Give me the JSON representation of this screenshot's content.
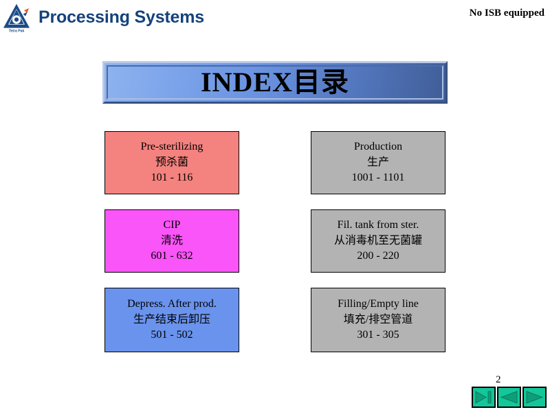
{
  "header": {
    "logo_name": "tetra-pak-logo",
    "logo_wordmark": "Tetra Pak",
    "title": "Processing Systems",
    "note": "No ISB equipped",
    "title_color": "#15427c"
  },
  "banner": {
    "title": "INDEX目录",
    "gradient_from": "#8fb3ef",
    "gradient_to": "#3f5d97"
  },
  "index_boxes": [
    {
      "id": "pre-sterilizing",
      "title_en": "Pre-sterilizing",
      "title_zh": "预杀菌",
      "range": "101 - 116",
      "color": "#F4827F"
    },
    {
      "id": "cip",
      "title_en": "CIP",
      "title_zh": "清洗",
      "range": "601 - 632",
      "color": "#FA55F8"
    },
    {
      "id": "depress-after-prod",
      "title_en": "Depress. After prod.",
      "title_zh": "生产结束后卸压",
      "range": "501 - 502",
      "color": "#6A93ED"
    },
    {
      "id": "production",
      "title_en": "Production",
      "title_zh": "生产",
      "range": "1001 - 1101",
      "color": "#B3B3B3"
    },
    {
      "id": "fil-tank-from-ster",
      "title_en": "Fil. tank from ster.",
      "title_zh": "从消毒机至无菌罐",
      "range": "200 - 220",
      "color": "#B3B3B3"
    },
    {
      "id": "filling-empty-line",
      "title_en": "Filling/Empty line",
      "title_zh": "填充/排空管道",
      "range": "301 - 305",
      "color": "#B3B3B3"
    }
  ],
  "footer": {
    "page_number": "2",
    "nav": [
      {
        "id": "play-to-end",
        "icon": "play-to-end-icon"
      },
      {
        "id": "previous",
        "icon": "triangle-left-icon"
      },
      {
        "id": "next",
        "icon": "triangle-right-icon"
      }
    ],
    "nav_color": "#13C79A"
  }
}
